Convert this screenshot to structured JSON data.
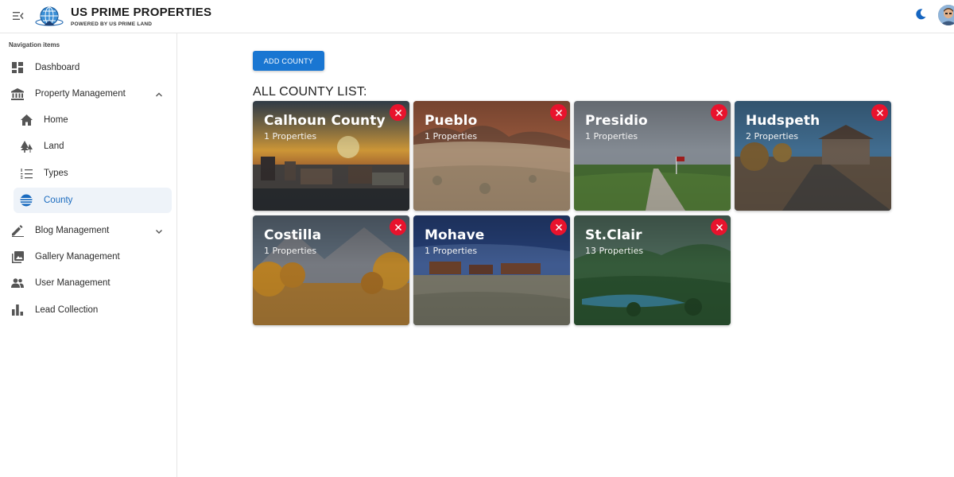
{
  "header": {
    "title": "US PRIME PROPERTIES",
    "subtitle": "POWERED BY US PRIME LAND",
    "menu_icon": "menu-collapse-icon",
    "theme_icon": "moon-icon",
    "accent": "#1976d2"
  },
  "sidebar": {
    "caption": "Navigation items",
    "items": [
      {
        "label": "Dashboard",
        "icon": "dashboard-icon"
      },
      {
        "label": "Property Management",
        "icon": "bank-icon",
        "expanded": true
      },
      {
        "label": "Home",
        "icon": "home-icon"
      },
      {
        "label": "Land",
        "icon": "trees-icon"
      },
      {
        "label": "Types",
        "icon": "list-numbered-icon"
      },
      {
        "label": "County",
        "icon": "flag-globe-icon",
        "active": true
      },
      {
        "label": "Blog Management",
        "icon": "edit-icon",
        "expanded": false
      },
      {
        "label": "Gallery Management",
        "icon": "gallery-icon"
      },
      {
        "label": "User Management",
        "icon": "users-icon"
      },
      {
        "label": "Lead Collection",
        "icon": "bar-chart-icon"
      }
    ]
  },
  "main": {
    "add_button": "ADD COUNTY",
    "list_title": "ALL COUNTY LIST:",
    "delete_color": "#e8132d",
    "counties": [
      {
        "name": "Calhoun County",
        "count": "1 Properties"
      },
      {
        "name": "Pueblo",
        "count": "1 Properties"
      },
      {
        "name": "Presidio",
        "count": "1 Properties"
      },
      {
        "name": "Hudspeth",
        "count": "2 Properties"
      },
      {
        "name": "Costilla",
        "count": "1 Properties"
      },
      {
        "name": "Mohave",
        "count": "1 Properties"
      },
      {
        "name": "St.Clair",
        "count": "13 Properties"
      }
    ]
  }
}
